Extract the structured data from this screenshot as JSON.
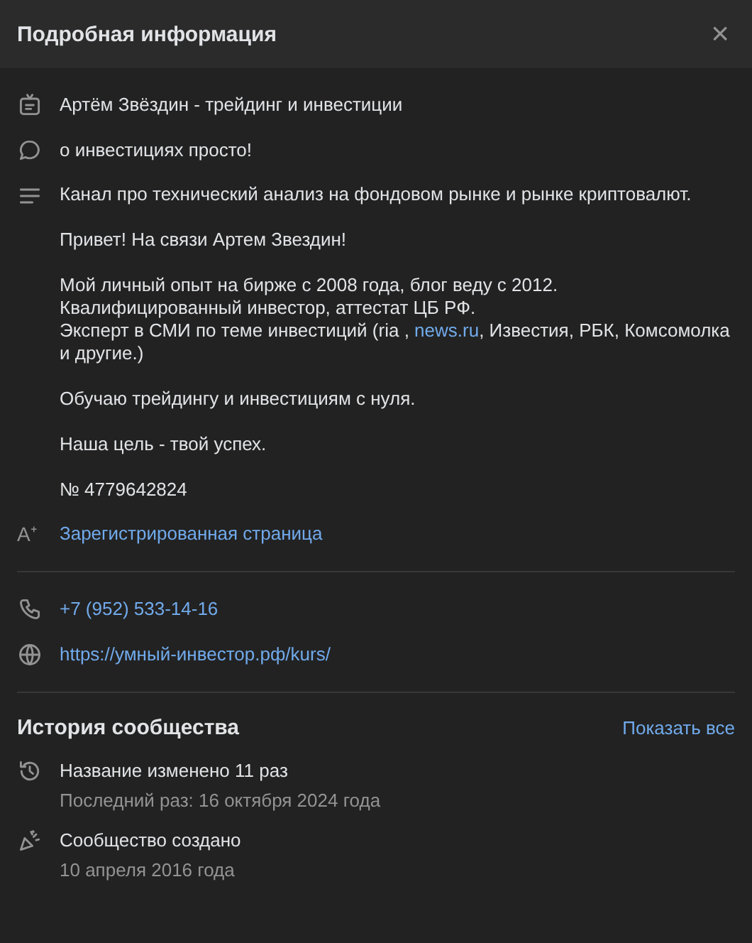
{
  "header": {
    "title": "Подробная информация",
    "close": "×"
  },
  "info": [
    {
      "kind": "name",
      "text": "Артём Звёздин - трейдинг и инвестиции"
    },
    {
      "kind": "status",
      "text": "о инвестициях просто!"
    }
  ],
  "description": [
    [
      [
        {
          "kind": "text",
          "text": "Канал про технический анализ на фондовом рынке и рынке криптовалют."
        }
      ]
    ],
    [
      [
        {
          "kind": "text",
          "text": "Привет! На связи Артем Звездин!"
        }
      ]
    ],
    [
      [
        {
          "kind": "text",
          "text": "Мой личный опыт на бирже с 2008 года, блог веду с 2012."
        }
      ],
      [
        {
          "kind": "text",
          "text": "Квалифицированный инвестор, аттестат ЦБ РФ."
        }
      ],
      [
        {
          "kind": "text",
          "text": "Эксперт в СМИ по теме инвестиций (ria , "
        },
        {
          "kind": "link",
          "text": "news.ru"
        },
        {
          "kind": "text",
          "text": ", Известия, РБК, Комсомолка"
        }
      ],
      [
        {
          "kind": "text",
          "text": "и другие.)"
        }
      ]
    ],
    [
      [
        {
          "kind": "text",
          "text": "Обучаю трейдингу и инвестициям с нуля."
        }
      ]
    ],
    [
      [
        {
          "kind": "text",
          "text": "Наша цель - твой успех."
        }
      ]
    ],
    [
      [
        {
          "kind": "text",
          "text": "№ 4779642824"
        }
      ]
    ]
  ],
  "registered": {
    "icon": "A⁺",
    "text": "Зарегистрированная страница"
  },
  "contacts": [
    {
      "kind": "phone",
      "text": "+7 (952) 533-14-16"
    },
    {
      "kind": "site",
      "text": "https://умный-инвестор.рф/kurs/"
    }
  ],
  "history": {
    "title": "История сообщества",
    "show_all": "Показать все",
    "items": [
      {
        "kind": "renamed",
        "title": "Название изменено 11 раз",
        "subtitle": "Последний раз: 16 октября 2024 года"
      },
      {
        "kind": "created",
        "title": "Сообщество создано",
        "subtitle": "10 апреля 2016 года"
      }
    ]
  }
}
